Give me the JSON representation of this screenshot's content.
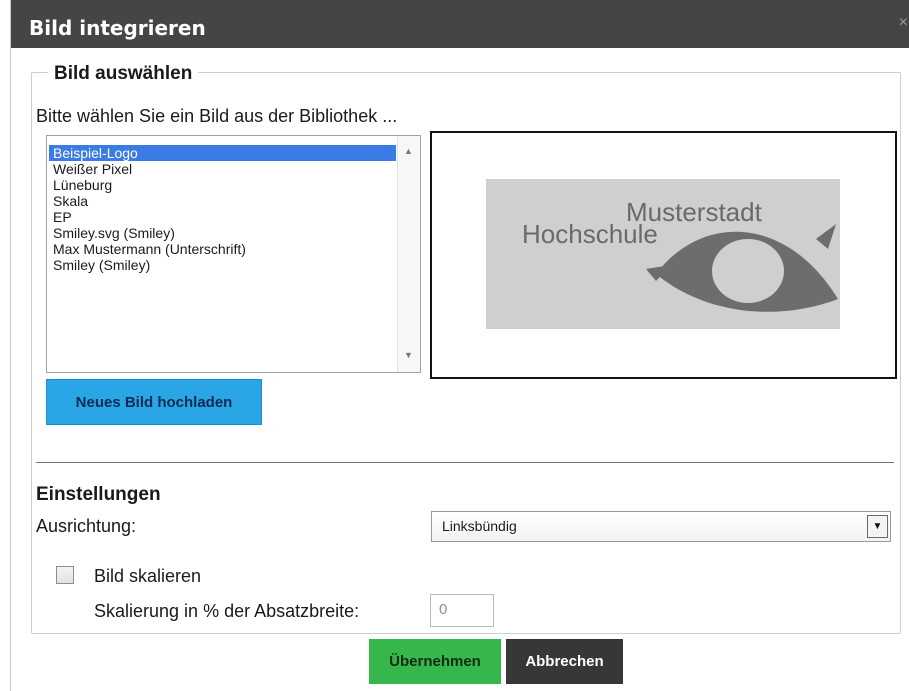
{
  "dialog": {
    "title": "Bild integrieren",
    "close_glyph": "×"
  },
  "bild_auswaehlen": {
    "legend": "Bild auswählen",
    "intro": "Bitte wählen Sie ein Bild aus der Bibliothek ...",
    "list": {
      "selected_index": 0,
      "items": [
        "Beispiel-Logo",
        "Weißer Pixel",
        "Lüneburg",
        "Skala",
        "EP",
        "Smiley.svg (Smiley)",
        "Max Mustermann (Unterschrift)",
        "Smiley (Smiley)"
      ]
    },
    "preview": {
      "logo_text_1": "Musterstadt",
      "logo_text_2": "Hochschule"
    },
    "upload_button": "Neues Bild hochladen"
  },
  "einstellungen": {
    "title": "Einstellungen",
    "ausrichtung_label": "Ausrichtung:",
    "ausrichtung_value": "Linksbündig",
    "scale_checkbox_label": "Bild skalieren",
    "scale_checkbox_checked": false,
    "scale_percent_label": "Skalierung in % der Absatzbreite:",
    "scale_percent_value": "0"
  },
  "footer": {
    "apply": "Übernehmen",
    "cancel": "Abbrechen"
  },
  "colors": {
    "titlebar": "#454545",
    "selection": "#3b7be6",
    "upload_button": "#2aa5e6",
    "apply_button": "#35b74c",
    "cancel_button": "#373737"
  }
}
